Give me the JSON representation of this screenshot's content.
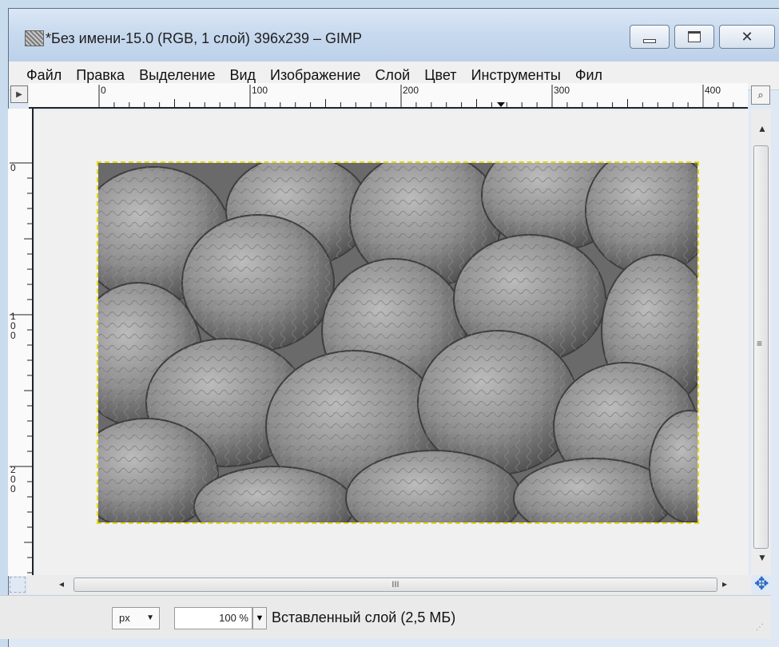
{
  "window": {
    "title": "*Без имени-15.0 (RGB, 1 слой) 396x239 – GIMP"
  },
  "menu": {
    "items": [
      "Файл",
      "Правка",
      "Выделение",
      "Вид",
      "Изображение",
      "Слой",
      "Цвет",
      "Инструменты",
      "Фил"
    ]
  },
  "rulers": {
    "horizontal_labels": [
      "0",
      "100",
      "200",
      "300",
      "400"
    ],
    "vertical_labels": [
      "0",
      "100",
      "200"
    ]
  },
  "scrollbar": {
    "grip_symbol": "III"
  },
  "status": {
    "unit": "px",
    "zoom": "100 %",
    "layer_info": "Вставленный слой (2,5 МБ)"
  },
  "icons": {
    "app": "gimp-image-icon",
    "navigate": "navigate-icon",
    "zoom_fit": "zoom-icon",
    "quick_mask": "quick-mask-icon"
  },
  "colors": {
    "selection_border": "#e4d810",
    "canvas_bg": "#f0f0f0"
  }
}
